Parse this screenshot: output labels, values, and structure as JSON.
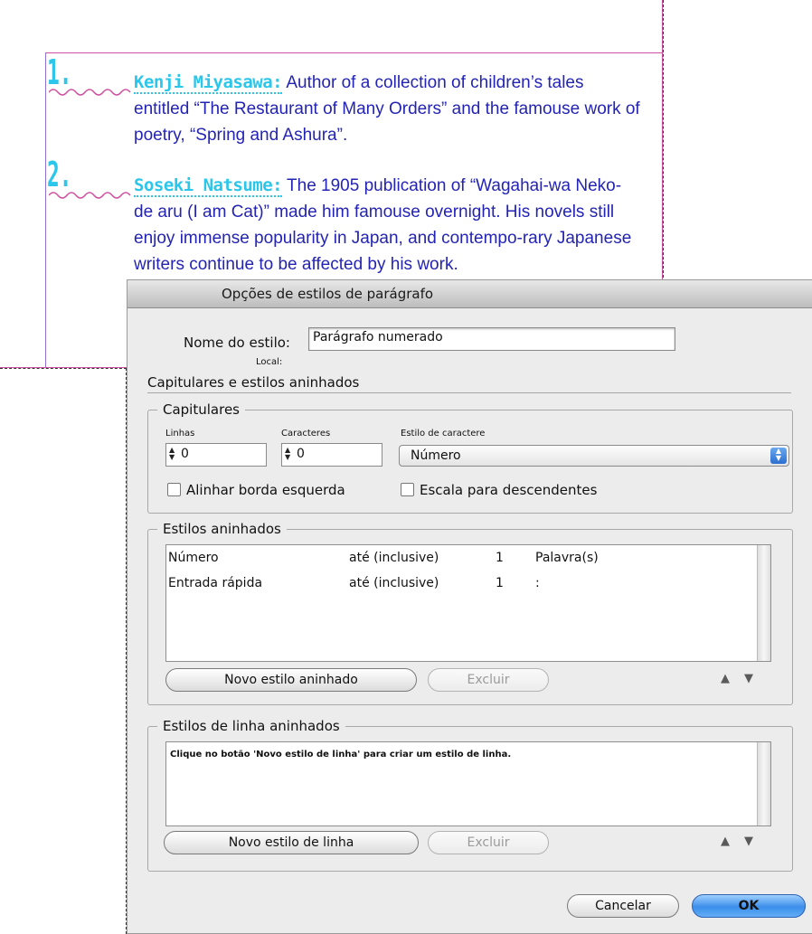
{
  "document": {
    "items": [
      {
        "number": "1.",
        "name": "Kenji Miyasawa:",
        "text": " Author of a collection of children’s tales entitled “The Restaurant of Many Orders” and the famouse work of poetry, “Spring and Ashura”."
      },
      {
        "number": "2.",
        "name": "Soseki Natsume:",
        "text": " The 1905 publication of “Wagahai-wa Neko-de aru (I am Cat)” made him famouse overnight. His novels still enjoy immense popularity in Japan, and contempo-rary Japanese writers continue to be affected by his work."
      }
    ],
    "colors": {
      "number": "#2bc6ea",
      "body": "#2424b4",
      "margin": "#d04fa0"
    }
  },
  "dialog": {
    "title": "Opções de estilos de parágrafo",
    "style_name_label": "Nome do estilo:",
    "style_name_value": "Parágrafo numerado",
    "location_label": "Local:",
    "section_title": "Capitulares e estilos aninhados",
    "drop_caps": {
      "legend": "Capitulares",
      "lines_label": "Linhas",
      "lines_value": "0",
      "chars_label": "Caracteres",
      "chars_value": "0",
      "char_style_label": "Estilo de caractere",
      "char_style_value": "Número",
      "align_left_label": "Alinhar borda esquerda",
      "scale_desc_label": "Escala para descendentes"
    },
    "nested_styles": {
      "legend": "Estilos aninhados",
      "rows": [
        {
          "style": "Número",
          "mode": "até (inclusive)",
          "count": "1",
          "unit": "Palavra(s)"
        },
        {
          "style": "Entrada rápida",
          "mode": "até (inclusive)",
          "count": "1",
          "unit": ":"
        }
      ],
      "new_button": "Novo estilo aninhado",
      "delete_button": "Excluir"
    },
    "nested_line_styles": {
      "legend": "Estilos de linha aninhados",
      "message": "Clique no botão 'Novo estilo de linha' para criar um estilo de linha.",
      "new_button": "Novo estilo de linha",
      "delete_button": "Excluir"
    },
    "cancel_button": "Cancelar",
    "ok_button": "OK"
  }
}
